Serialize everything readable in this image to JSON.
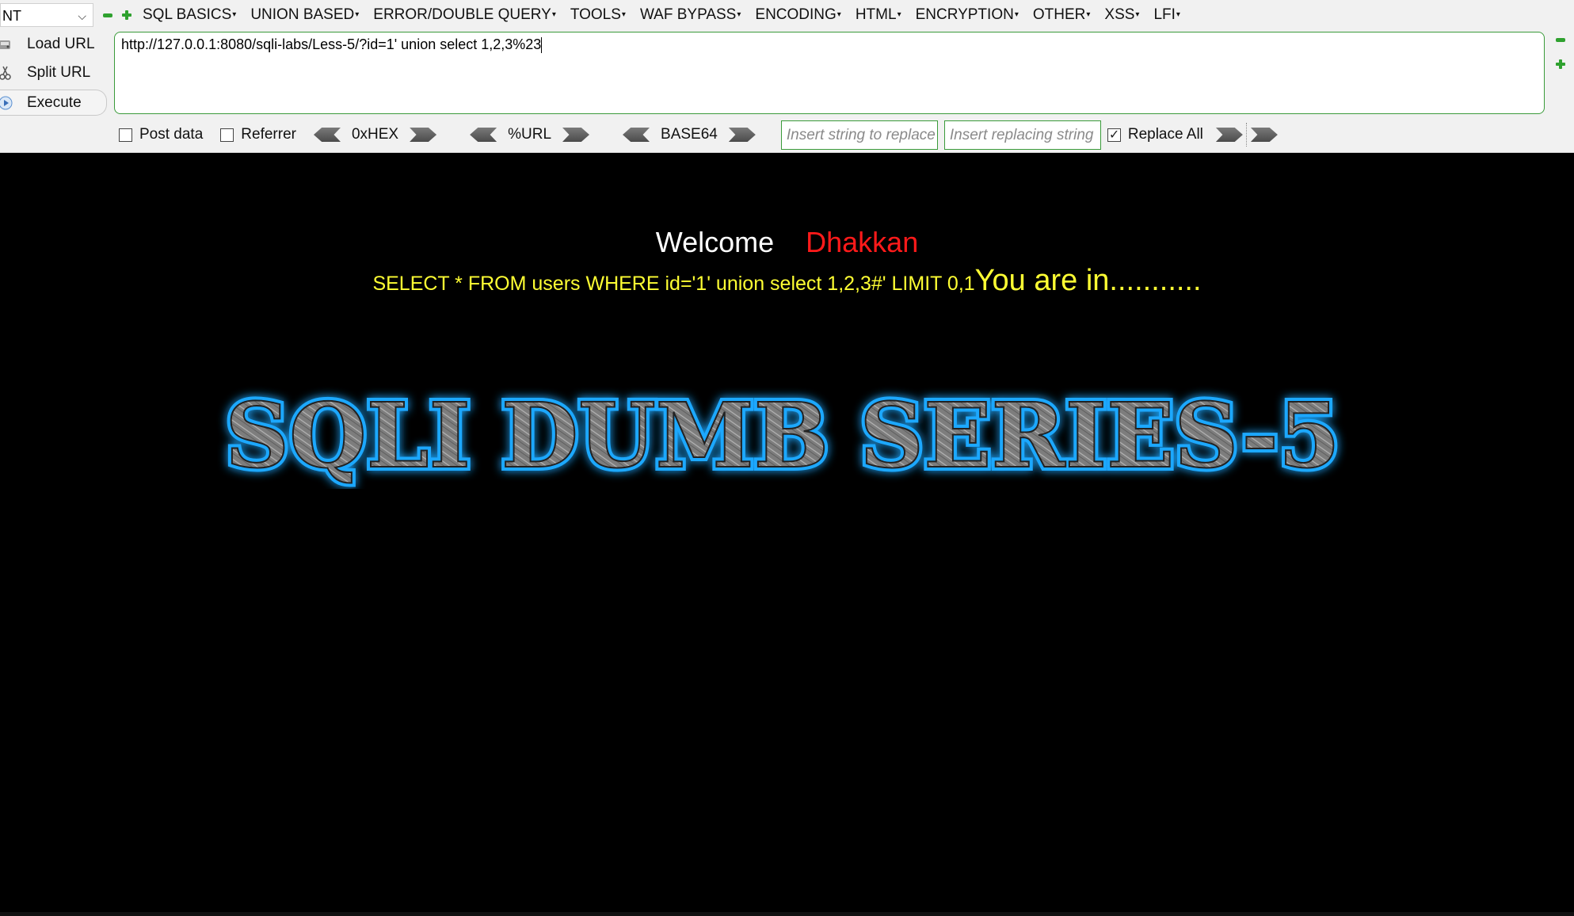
{
  "hackbar": {
    "version_select": "NT",
    "menu": [
      "SQL BASICS",
      "UNION BASED",
      "ERROR/DOUBLE QUERY",
      "TOOLS",
      "WAF BYPASS",
      "ENCODING",
      "HTML",
      "ENCRYPTION",
      "OTHER",
      "XSS",
      "LFI"
    ],
    "actions": {
      "load": "Load URL",
      "split": "Split URL",
      "execute": "Execute"
    },
    "url_value": "http://127.0.0.1:8080/sqli-labs/Less-5/?id=1' union select 1,2,3%23",
    "options": {
      "post_data": "Post data",
      "referrer": "Referrer",
      "hex": "0xHEX",
      "url": "%URL",
      "base64": "BASE64",
      "replace_placeholder": "Insert string to replace",
      "replacing_placeholder": "Insert replacing string",
      "replace_all": "Replace All"
    }
  },
  "page": {
    "welcome": "Welcome",
    "user": "Dhakkan",
    "query": "SELECT * FROM users WHERE id='1' union select 1,2,3#' LIMIT 0,1",
    "status": "You are in...........",
    "banner": "SQLI DUMB SERIES-5"
  },
  "colors": {
    "background": "#000000",
    "welcome": "#ffffff",
    "user": "#ff1a1a",
    "query": "#ffff33",
    "banner_glow": "#1fa8ff",
    "input_border": "#3a9b3a"
  }
}
